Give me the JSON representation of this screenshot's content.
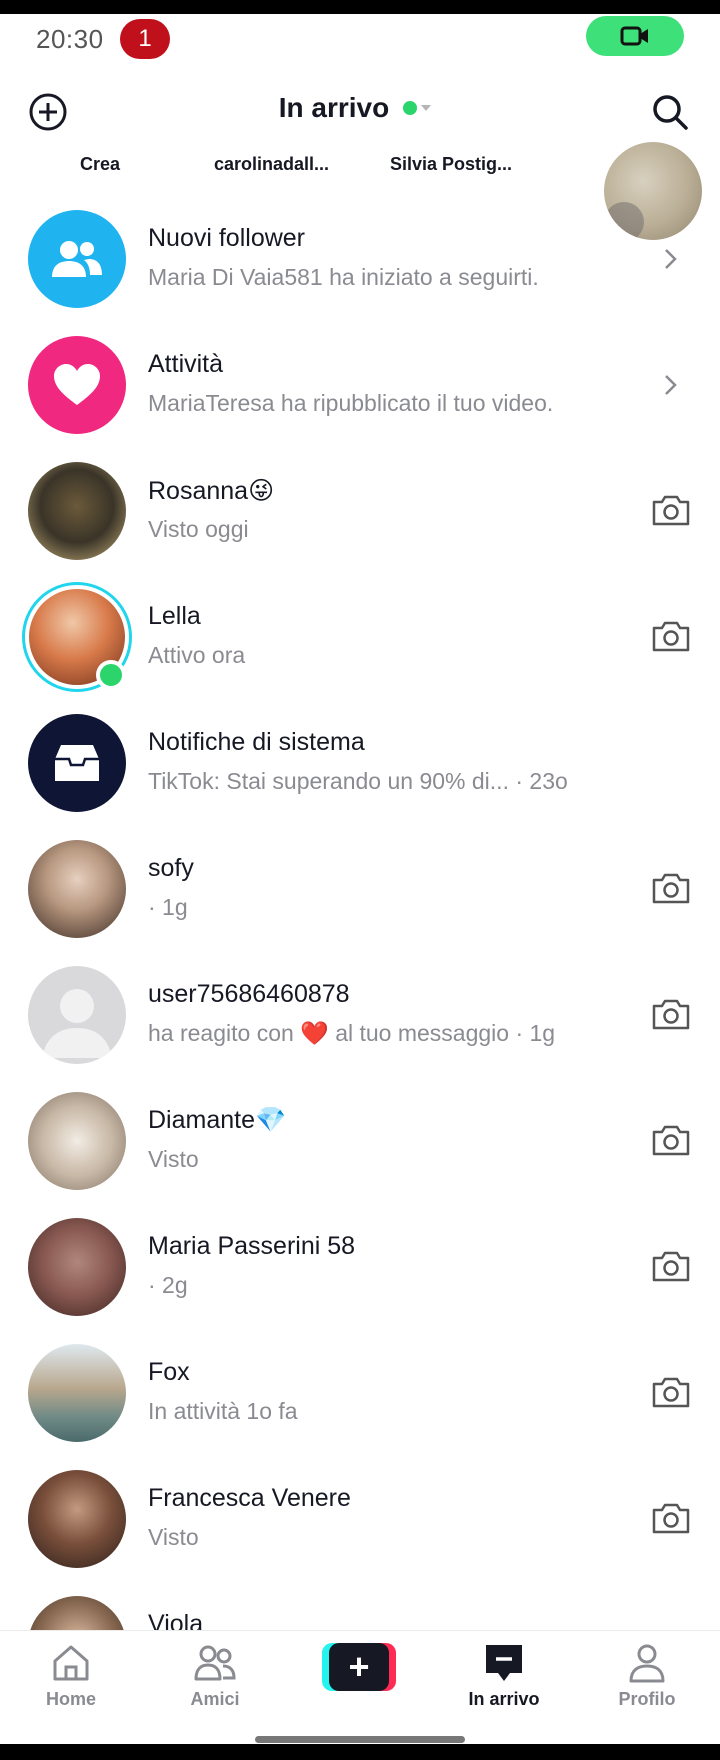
{
  "status_bar": {
    "time": "20:30",
    "badge_count": "1"
  },
  "header": {
    "title": "In arrivo"
  },
  "stories": [
    "Crea",
    "carolinadall...",
    "Silvia Postig..."
  ],
  "rows": [
    {
      "title": "Nuovi follower",
      "subtitle": "Maria Di Vaia581 ha iniziato a seguirti."
    },
    {
      "title": "Attività",
      "subtitle": "MariaTeresa ha ripubblicato il tuo video."
    },
    {
      "title": "Rosanna😜",
      "subtitle": "Visto oggi"
    },
    {
      "title": "Lella",
      "subtitle": "Attivo ora"
    },
    {
      "title": "Notifiche di sistema",
      "subtitle": "TikTok: Stai superando un 90% di...  · 23o"
    },
    {
      "title": "sofy",
      "subtitle": " · 1g"
    },
    {
      "title": "user75686460878",
      "subtitle": "ha reagito con ❤️ al tuo messaggio · 1g"
    },
    {
      "title": "Diamante💎",
      "subtitle": "Visto"
    },
    {
      "title": "Maria  Passerini  58",
      "subtitle": " · 2g"
    },
    {
      "title": "Fox",
      "subtitle": "In attività 1o fa"
    },
    {
      "title": "Francesca Venere",
      "subtitle": "Visto"
    },
    {
      "title": "Viola",
      "subtitle": ""
    }
  ],
  "nav": {
    "home": "Home",
    "friends": "Amici",
    "inbox": "In arrivo",
    "profile": "Profilo"
  },
  "icons": {
    "followers": "people-icon",
    "activity": "heart-icon",
    "system": "inbox-box-icon",
    "camera": "camera-icon",
    "chevron": "chevron-right-icon"
  },
  "colors": {
    "followers_bg": "#1fb3f0",
    "activity_bg": "#f0287f",
    "system_bg": "#0f1534",
    "online": "#2bd56b",
    "story_ring": "#20d5ec",
    "badge": "#c0101b",
    "video_pill": "#3ee07a"
  }
}
